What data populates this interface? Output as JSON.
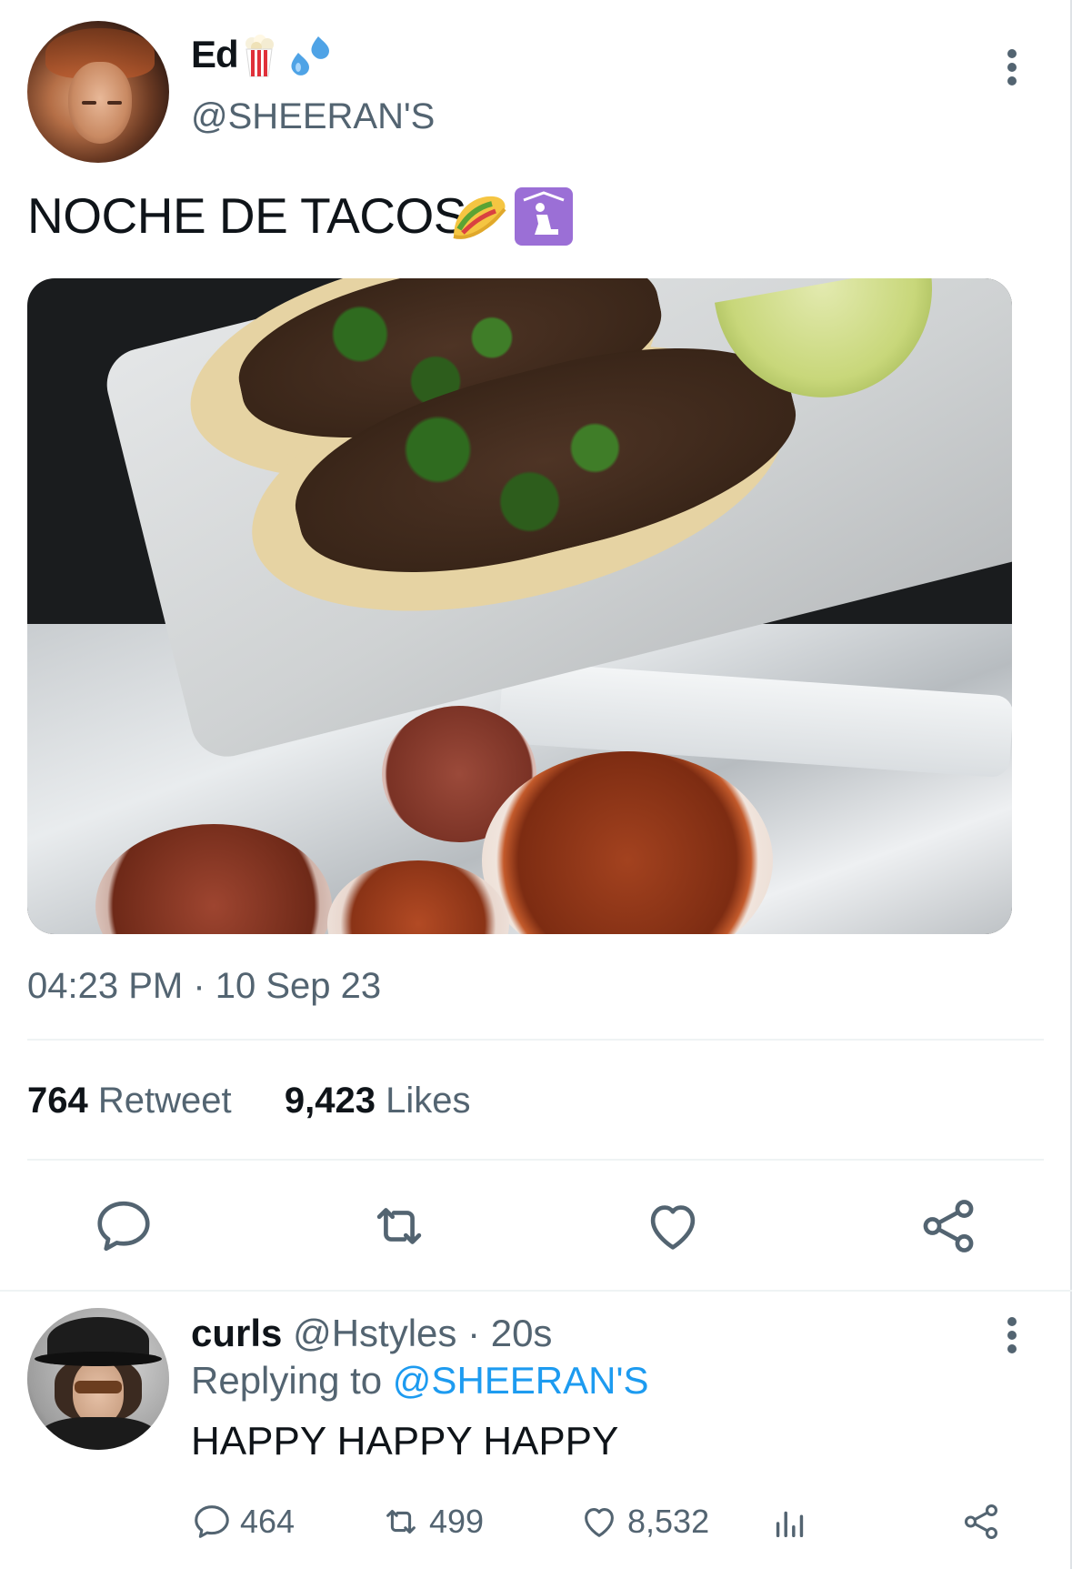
{
  "main_tweet": {
    "display_name": "Ed",
    "name_emojis": [
      "popcorn-emoji",
      "sweat-droplets-emoji"
    ],
    "handle": "@SHEERAN'S",
    "text": "NOCHE DE TACOS",
    "text_emojis": [
      "taco-emoji",
      "place-of-worship-emoji"
    ],
    "image_alt": "tacos with cilantro, lime and salsa cups",
    "timestamp": "04:23 PM · 10 Sep 23",
    "retweets_count": "764",
    "retweets_label": "Retweet",
    "likes_count": "9,423",
    "likes_label": "Likes",
    "actions": [
      "reply-icon",
      "retweet-icon",
      "like-icon",
      "share-icon"
    ]
  },
  "reply": {
    "display_name": "curls",
    "handle": "@Hstyles",
    "time": "· 20s",
    "replying_prefix": "Replying to",
    "replying_to": "@SHEERAN'S",
    "text": "HAPPY HAPPY HAPPY",
    "replies_count": "464",
    "retweets_count": "499",
    "likes_count": "8,532",
    "actions": [
      "reply-icon",
      "retweet-icon",
      "like-icon",
      "analytics-icon",
      "share-icon"
    ]
  },
  "colors": {
    "text_primary": "#0f1419",
    "text_secondary": "#536471",
    "link": "#1d9bf0",
    "divider": "#eff3f4"
  }
}
